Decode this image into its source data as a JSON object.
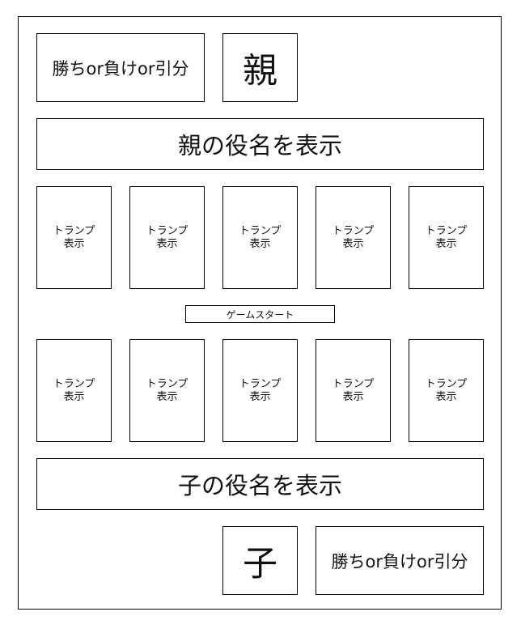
{
  "dealer": {
    "result": "勝ちor負けor引分",
    "label": "親",
    "hand_name": "親の役名を表示"
  },
  "dealer_cards": [
    {
      "line1": "トランプ",
      "line2": "表示"
    },
    {
      "line1": "トランプ",
      "line2": "表示"
    },
    {
      "line1": "トランプ",
      "line2": "表示"
    },
    {
      "line1": "トランプ",
      "line2": "表示"
    },
    {
      "line1": "トランプ",
      "line2": "表示"
    }
  ],
  "start_button": {
    "label": "ゲームスタート"
  },
  "player_cards": [
    {
      "line1": "トランプ",
      "line2": "表示"
    },
    {
      "line1": "トランプ",
      "line2": "表示"
    },
    {
      "line1": "トランプ",
      "line2": "表示"
    },
    {
      "line1": "トランプ",
      "line2": "表示"
    },
    {
      "line1": "トランプ",
      "line2": "表示"
    }
  ],
  "player": {
    "hand_name": "子の役名を表示",
    "label": "子",
    "result": "勝ちor負けor引分"
  }
}
